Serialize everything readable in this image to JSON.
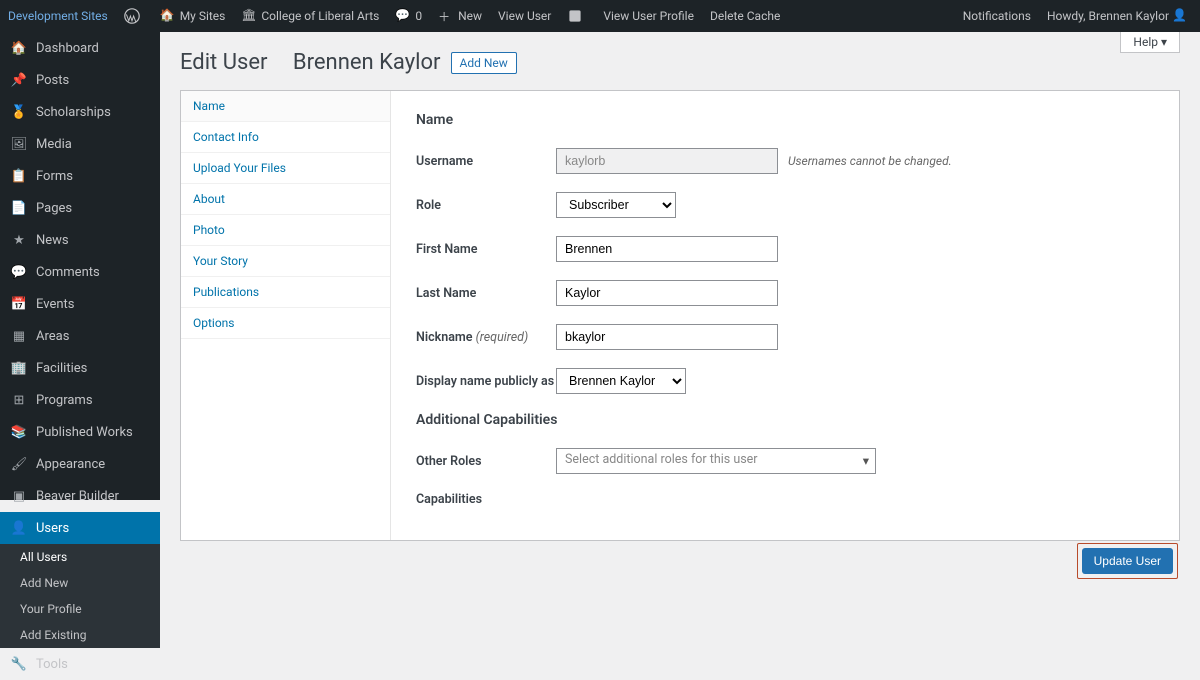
{
  "adminbar": {
    "site_network": "Development Sites",
    "mysites": "My Sites",
    "site": "College of Liberal Arts",
    "comments": "0",
    "new": "New",
    "view_user": "View User",
    "view_user_profile": "View User Profile",
    "delete_cache": "Delete Cache",
    "notifications": "Notifications",
    "howdy": "Howdy, Brennen Kaylor"
  },
  "sidebar": {
    "items": [
      {
        "label": "Dashboard",
        "icon": "dash"
      },
      {
        "label": "Posts",
        "icon": "pin"
      },
      {
        "label": "Scholarships",
        "icon": "award"
      },
      {
        "label": "Media",
        "icon": "media"
      },
      {
        "label": "Forms",
        "icon": "forms"
      },
      {
        "label": "Pages",
        "icon": "pages"
      },
      {
        "label": "News",
        "icon": "star"
      },
      {
        "label": "Comments",
        "icon": "comment"
      },
      {
        "label": "Events",
        "icon": "cal"
      },
      {
        "label": "Areas",
        "icon": "grid"
      },
      {
        "label": "Facilities",
        "icon": "build"
      },
      {
        "label": "Programs",
        "icon": "prog"
      },
      {
        "label": "Published Works",
        "icon": "book"
      },
      {
        "label": "Appearance",
        "icon": "brush"
      },
      {
        "label": "Beaver Builder",
        "icon": "bb"
      },
      {
        "label": "Users",
        "icon": "user"
      },
      {
        "label": "Tools",
        "icon": "tools"
      }
    ],
    "users_sub": [
      {
        "label": "All Users"
      },
      {
        "label": "Add New"
      },
      {
        "label": "Your Profile"
      },
      {
        "label": "Add Existing"
      }
    ]
  },
  "page": {
    "title_prefix": "Edit User",
    "title_name": "Brennen Kaylor",
    "add_new": "Add New",
    "help": "Help ▾"
  },
  "subnav": [
    {
      "label": "Name"
    },
    {
      "label": "Contact Info"
    },
    {
      "label": "Upload Your Files"
    },
    {
      "label": "About"
    },
    {
      "label": "Photo"
    },
    {
      "label": "Your Story"
    },
    {
      "label": "Publications"
    },
    {
      "label": "Options"
    }
  ],
  "form": {
    "section1": "Name",
    "username_label": "Username",
    "username_value": "kaylorb",
    "username_hint": "Usernames cannot be changed.",
    "role_label": "Role",
    "role_value": "Subscriber",
    "first_label": "First Name",
    "first_value": "Brennen",
    "last_label": "Last Name",
    "last_value": "Kaylor",
    "nick_label": "Nickname",
    "nick_req": "(required)",
    "nick_value": "bkaylor",
    "display_label": "Display name publicly as",
    "display_value": "Brennen Kaylor",
    "section2": "Additional Capabilities",
    "other_roles_label": "Other Roles",
    "other_roles_placeholder": "Select additional roles for this user",
    "cap_label": "Capabilities",
    "update": "Update User"
  }
}
